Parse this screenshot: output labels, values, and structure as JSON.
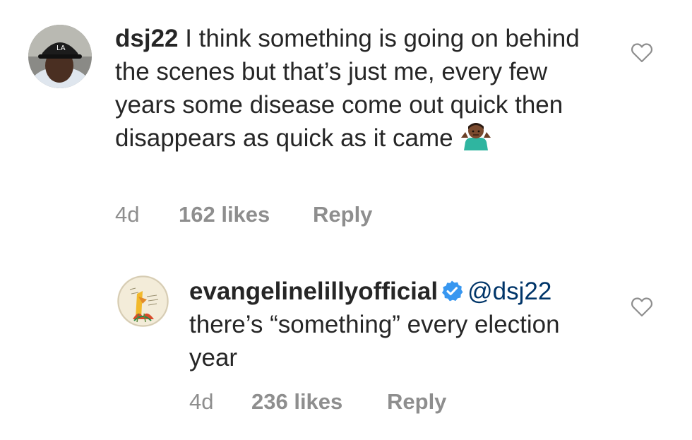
{
  "comments": [
    {
      "username": "dsj22",
      "text": "I think something is going on behind the scenes but that’s just me, every few years some disease come out quick then disappears as quick as it came",
      "emoji": "man-shrugging-emoji",
      "time": "4d",
      "likes": "162 likes",
      "reply_label": "Reply",
      "like_icon": "heart-outline-icon"
    }
  ],
  "replies": [
    {
      "username": "evangelinelillyofficial",
      "verified": true,
      "mention": "@dsj22",
      "text": "there’s “something” every election year",
      "time": "4d",
      "likes": "236 likes",
      "reply_label": "Reply",
      "like_icon": "heart-outline-icon"
    }
  ],
  "colors": {
    "text": "#262626",
    "meta": "#8e8e8e",
    "mention": "#003569",
    "verified": "#3897f0"
  }
}
